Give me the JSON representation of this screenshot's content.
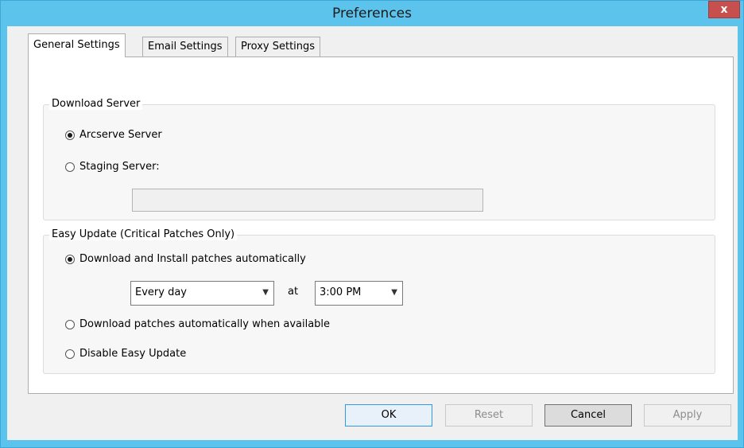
{
  "window": {
    "title": "Preferences",
    "close_label": "x"
  },
  "tabs": [
    {
      "label": "General Settings",
      "active": true
    },
    {
      "label": "Email Settings",
      "active": false
    },
    {
      "label": "Proxy Settings",
      "active": false
    }
  ],
  "download_server": {
    "legend": "Download Server",
    "options": [
      {
        "label": "Arcserve Server",
        "checked": true
      },
      {
        "label": "Staging Server:",
        "checked": false
      }
    ],
    "staging_value": ""
  },
  "easy_update": {
    "legend": "Easy Update (Critical Patches Only)",
    "options": [
      {
        "label": "Download and Install patches automatically",
        "checked": true
      },
      {
        "label": "Download patches automatically when available",
        "checked": false
      },
      {
        "label": "Disable Easy Update",
        "checked": false
      }
    ],
    "frequency": "Every day",
    "at_label": "at",
    "time": "3:00 PM"
  },
  "buttons": {
    "ok": "OK",
    "reset": "Reset",
    "cancel": "Cancel",
    "apply": "Apply"
  }
}
